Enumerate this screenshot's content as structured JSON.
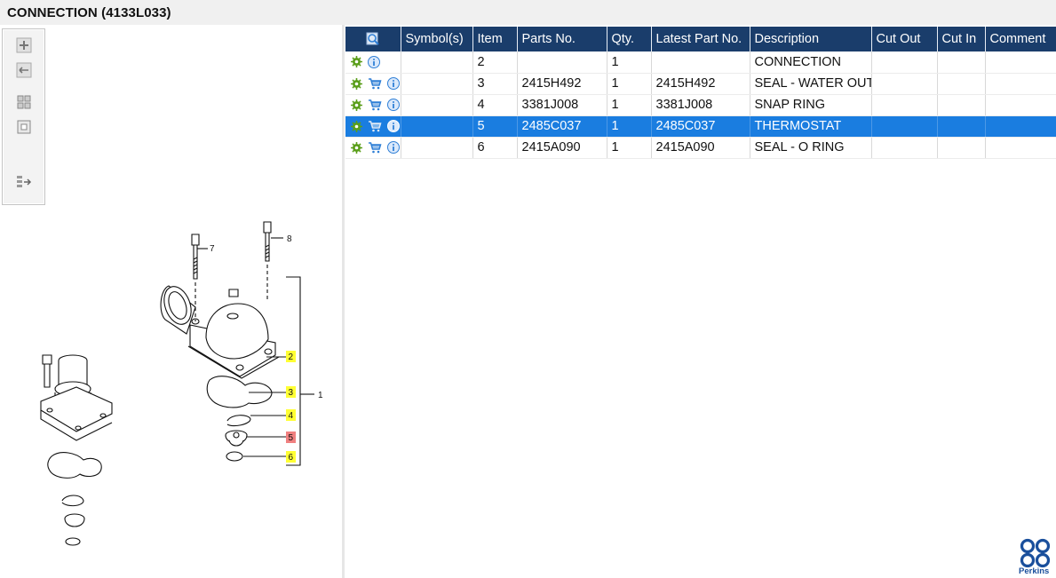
{
  "window": {
    "title": "CONNECTION (4133L033)"
  },
  "toolbar": {
    "buttons": [
      {
        "name": "zoom-in",
        "icon": "plus-icon"
      },
      {
        "name": "zoom-out",
        "icon": "minus-icon"
      },
      {
        "name": "fit-all",
        "icon": "grid-icon"
      },
      {
        "name": "fit-window",
        "icon": "square-icon"
      },
      {
        "name": "export",
        "icon": "export-list-icon"
      }
    ]
  },
  "diagram": {
    "callouts": [
      {
        "label": "7"
      },
      {
        "label": "8"
      },
      {
        "label": "1"
      },
      {
        "label": "2",
        "highlight": "#ffff33"
      },
      {
        "label": "3",
        "highlight": "#ffff33"
      },
      {
        "label": "4",
        "highlight": "#ffff33"
      },
      {
        "label": "5",
        "highlight": "#f08080"
      },
      {
        "label": "6",
        "highlight": "#ffff33"
      }
    ]
  },
  "table": {
    "columns": [
      "Symbol(s)",
      "Item",
      "Parts No.",
      "Qty.",
      "Latest Part No.",
      "Description",
      "Cut Out",
      "Cut In",
      "Comment"
    ],
    "rows": [
      {
        "item": "2",
        "parts_no": "",
        "qty": "1",
        "latest_part_no": "",
        "description": "CONNECTION",
        "cut_out": "",
        "cut_in": "",
        "comment": "",
        "cart": false,
        "selected": false
      },
      {
        "item": "3",
        "parts_no": "2415H492",
        "qty": "1",
        "latest_part_no": "2415H492",
        "description": "SEAL - WATER OUTLET",
        "cut_out": "",
        "cut_in": "",
        "comment": "",
        "cart": true,
        "selected": false
      },
      {
        "item": "4",
        "parts_no": "3381J008",
        "qty": "1",
        "latest_part_no": "3381J008",
        "description": "SNAP RING",
        "cut_out": "",
        "cut_in": "",
        "comment": "",
        "cart": true,
        "selected": false
      },
      {
        "item": "5",
        "parts_no": "2485C037",
        "qty": "1",
        "latest_part_no": "2485C037",
        "description": "THERMOSTAT",
        "cut_out": "",
        "cut_in": "",
        "comment": "",
        "cart": true,
        "selected": true
      },
      {
        "item": "6",
        "parts_no": "2415A090",
        "qty": "1",
        "latest_part_no": "2415A090",
        "description": "SEAL - O RING",
        "cut_out": "",
        "cut_in": "",
        "comment": "",
        "cart": true,
        "selected": false
      }
    ]
  },
  "brand": {
    "name": "Perkins",
    "color": "#1a4f9c"
  },
  "colors": {
    "header": "#1a3d6b",
    "selected_row": "#1a7de0",
    "gear_icon": "#5a9e1a",
    "info_icon": "#2f7fd6"
  }
}
